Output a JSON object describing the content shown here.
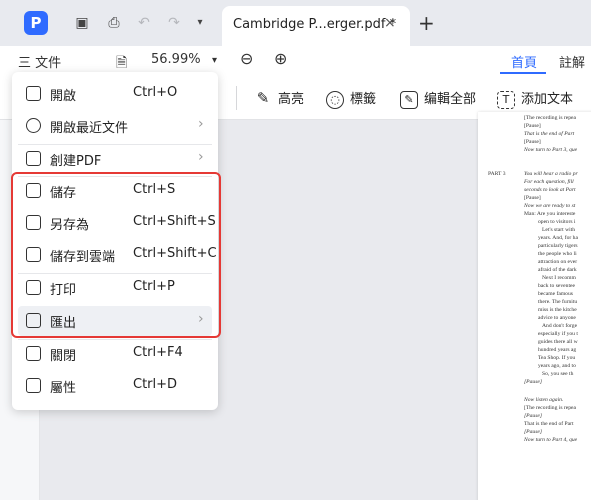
{
  "titlebar": {
    "tab_title": "Cambridge P...erger.pdf *",
    "tab_close": "×",
    "tab_add": "+"
  },
  "toolbar": {
    "menu_label": "三 文件",
    "zoom": "56.99%",
    "zoom_dropdown": "▾",
    "zoom_out": "⊖",
    "zoom_in": "⊕",
    "nav_home": "首頁",
    "nav_comment": "註解"
  },
  "toolbar2": {
    "highlight": "高亮",
    "label": "標籤",
    "edit_all": "编輯全部",
    "add_text": "添加文本"
  },
  "menu": {
    "items": [
      {
        "label": "開啟",
        "shortcut": "Ctrl+O"
      },
      {
        "label": "開啟最近文件",
        "shortcut": ""
      },
      {
        "label": "創建PDF",
        "shortcut": ""
      },
      {
        "label": "儲存",
        "shortcut": "Ctrl+S"
      },
      {
        "label": "另存為",
        "shortcut": "Ctrl+Shift+S"
      },
      {
        "label": "儲存到雲端",
        "shortcut": "Ctrl+Shift+C"
      },
      {
        "label": "打印",
        "shortcut": "Ctrl+P"
      },
      {
        "label": "匯出",
        "shortcut": ""
      },
      {
        "label": "關閉",
        "shortcut": "Ctrl+F4"
      },
      {
        "label": "屬性",
        "shortcut": "Ctrl+D"
      }
    ]
  },
  "pdf": {
    "lines": [
      "[The recording is repea",
      "[Pause]",
      "That is the end of Part",
      "[Pause]",
      "Now turn to Part 3, que",
      "PART 3",
      "You will hear a radio pr",
      "For each question, fill",
      "seconds to look at Part",
      "[Pause]",
      "Now we are ready to st",
      "Man: Are you intereste",
      "open to visitors i",
      "Let's start with",
      "years. And, for ha",
      "particularly tigers",
      "the people who li",
      "attraction on ever",
      "afraid of the dark",
      "Next I recomm",
      "back to seventee",
      "became famous",
      "there. The furnitu",
      "miss is the kitche",
      "advice to anyone",
      "And don't forge",
      "especially if you t",
      "guides there all w",
      "hundred years ag",
      "Tea Shop. If you",
      "years ago, and to",
      "So, you see th",
      "[Pause]",
      "Now listen again.",
      "[The recording is repea",
      "[Pause]",
      "That is the end of Part",
      "[Pause]",
      "Now turn to Part 4, que"
    ]
  }
}
